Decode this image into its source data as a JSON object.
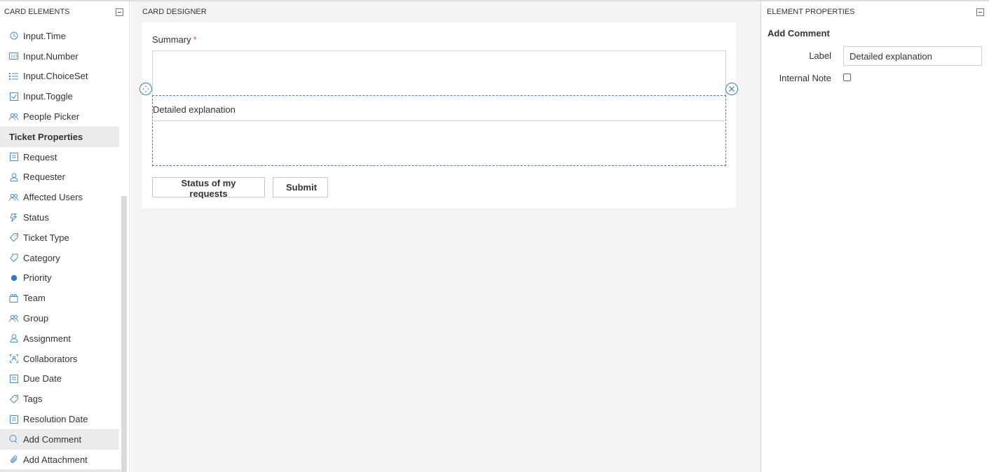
{
  "left_panel": {
    "title": "CARD ELEMENTS",
    "items_top": [
      {
        "label": "Input.Time",
        "icon": "clock-icon"
      },
      {
        "label": "Input.Number",
        "icon": "number-icon"
      },
      {
        "label": "Input.ChoiceSet",
        "icon": "list-icon"
      },
      {
        "label": "Input.Toggle",
        "icon": "checkbox-icon"
      },
      {
        "label": "People Picker",
        "icon": "people-icon"
      }
    ],
    "section_label": "Ticket Properties",
    "items_ticket": [
      {
        "label": "Request",
        "icon": "document-icon"
      },
      {
        "label": "Requester",
        "icon": "person-icon"
      },
      {
        "label": "Affected Users",
        "icon": "people-icon"
      },
      {
        "label": "Status",
        "icon": "status-icon"
      },
      {
        "label": "Ticket Type",
        "icon": "tag-icon"
      },
      {
        "label": "Category",
        "icon": "category-icon"
      },
      {
        "label": "Priority",
        "icon": "priority-dot-icon"
      },
      {
        "label": "Team",
        "icon": "team-icon"
      },
      {
        "label": "Group",
        "icon": "people-icon"
      },
      {
        "label": "Assignment",
        "icon": "person-icon"
      },
      {
        "label": "Collaborators",
        "icon": "collaborators-icon"
      },
      {
        "label": "Due Date",
        "icon": "calendar-icon"
      },
      {
        "label": "Tags",
        "icon": "tag-icon"
      },
      {
        "label": "Resolution Date",
        "icon": "calendar-icon"
      },
      {
        "label": "Add Comment",
        "icon": "comment-icon"
      },
      {
        "label": "Add Attachment",
        "icon": "paperclip-icon"
      }
    ],
    "active_item": "Add Comment"
  },
  "center_panel": {
    "title": "CARD DESIGNER",
    "summary_label": "Summary",
    "required_mark": "*",
    "selected_label": "Detailed explanation",
    "buttons": {
      "status": "Status of my requests",
      "submit": "Submit"
    }
  },
  "right_panel": {
    "title": "ELEMENT PROPERTIES",
    "element_title": "Add Comment",
    "label_field": "Label",
    "label_value": "Detailed explanation",
    "internal_note_field": "Internal Note",
    "internal_note_checked": false
  },
  "colors": {
    "accent": "#3b7fb8",
    "priority_dot": "#2e7ac3",
    "required": "#d9534f",
    "canvas_bg": "#f4f4f4",
    "active_bg": "#ebebeb"
  }
}
